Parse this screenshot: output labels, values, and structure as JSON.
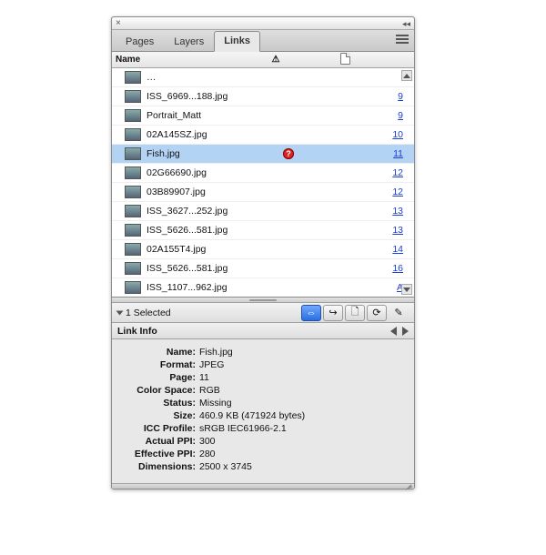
{
  "tabs": {
    "pages": "Pages",
    "layers": "Layers",
    "links": "Links"
  },
  "columns": {
    "name": "Name"
  },
  "rows": [
    {
      "thumb": "th1",
      "name": "…",
      "warn": false,
      "page": ""
    },
    {
      "thumb": "th2",
      "name": "ISS_6969...188.jpg",
      "warn": false,
      "page": "9"
    },
    {
      "thumb": "th3",
      "name": "Portrait_Matt",
      "warn": false,
      "page": "9"
    },
    {
      "thumb": "th4",
      "name": "02A145SZ.jpg",
      "warn": false,
      "page": "10"
    },
    {
      "thumb": "th3",
      "name": "Fish.jpg",
      "warn": true,
      "page": "11",
      "selected": true
    },
    {
      "thumb": "th5",
      "name": "02G66690.jpg",
      "warn": false,
      "page": "12"
    },
    {
      "thumb": "th6",
      "name": "03B89907.jpg",
      "warn": false,
      "page": "12"
    },
    {
      "thumb": "th7",
      "name": "ISS_3627...252.jpg",
      "warn": false,
      "page": "13"
    },
    {
      "thumb": "th2",
      "name": "ISS_5626...581.jpg",
      "warn": false,
      "page": "13"
    },
    {
      "thumb": "th8",
      "name": "02A155T4.jpg",
      "warn": false,
      "page": "14"
    },
    {
      "thumb": "th9",
      "name": "ISS_5626...581.jpg",
      "warn": false,
      "page": "16"
    },
    {
      "thumb": "th2",
      "name": "ISS_1107...962.jpg",
      "warn": false,
      "page": "A"
    }
  ],
  "status": {
    "selected": "1 Selected"
  },
  "linkinfo": {
    "title": "Link Info",
    "labels": {
      "name": "Name:",
      "format": "Format:",
      "page": "Page:",
      "colorspace": "Color Space:",
      "status": "Status:",
      "size": "Size:",
      "icc": "ICC Profile:",
      "actualppi": "Actual PPI:",
      "effppi": "Effective PPI:",
      "dims": "Dimensions:"
    },
    "values": {
      "name": "Fish.jpg",
      "format": "JPEG",
      "page": "11",
      "colorspace": "RGB",
      "status": "Missing",
      "size": "460.9 KB (471924 bytes)",
      "icc": "sRGB IEC61966-2.1",
      "actualppi": "300",
      "effppi": "280",
      "dims": "2500 x 3745"
    }
  }
}
